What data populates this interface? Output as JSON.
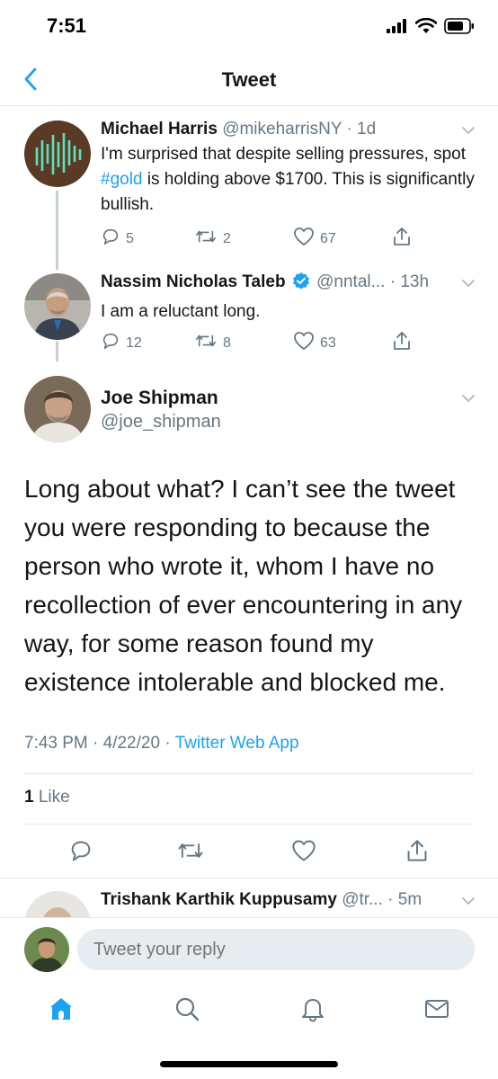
{
  "status_bar": {
    "time": "7:51"
  },
  "header": {
    "title": "Tweet"
  },
  "tweets": [
    {
      "name": "Michael Harris",
      "handle": "@mikeharrisNY",
      "time": "1d",
      "text_before": "I'm surprised that despite selling pressures, spot ",
      "hashtag": "#gold",
      "text_after": " is holding above $1700. This is significantly bullish.",
      "replies": "5",
      "retweets": "2",
      "likes": "67"
    },
    {
      "name": "Nassim Nicholas Taleb",
      "handle": "@nntal...",
      "time": "13h",
      "text": "I am a reluctant long.",
      "replies": "12",
      "retweets": "8",
      "likes": "63"
    }
  ],
  "main_tweet": {
    "name": "Joe Shipman",
    "handle": "@joe_shipman",
    "text": "Long about what? I can’t see the tweet you were responding to because the person who wrote it, whom I have no recollection of ever encountering in any way, for some reason found my existence intolerable and blocked me.",
    "timestamp": "7:43 PM · 4/22/20 · ",
    "source": "Twitter Web App",
    "like_count": "1",
    "like_label": " Like"
  },
  "next_reply": {
    "name": "Trishank Karthik Kuppusamy",
    "handle": "@tr...",
    "time": "5m"
  },
  "reply_bar": {
    "placeholder": "Tweet your reply"
  },
  "colors": {
    "accent": "#1da1f2",
    "muted": "#657786",
    "divider": "#e1e8ed"
  }
}
